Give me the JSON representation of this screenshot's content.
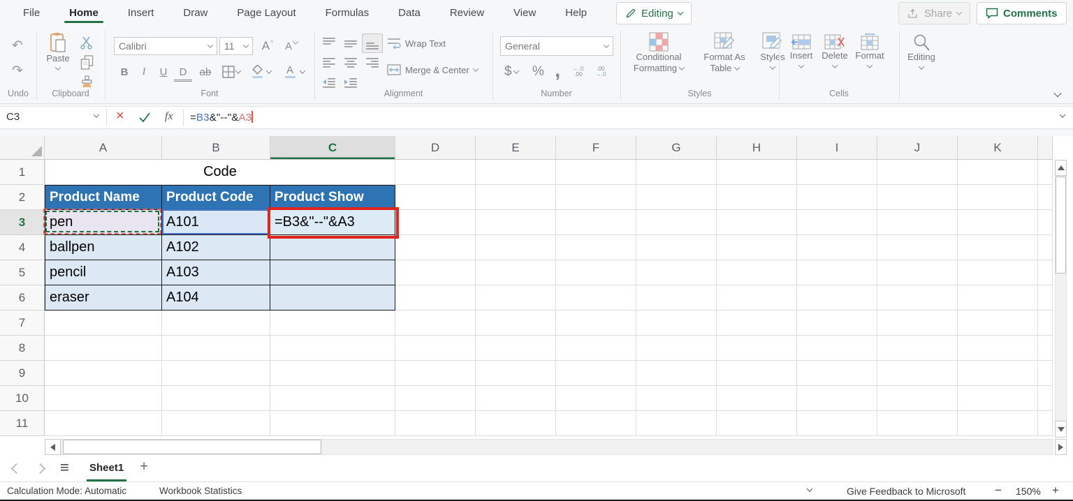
{
  "app": {
    "tabs": [
      "File",
      "Home",
      "Insert",
      "Draw",
      "Page Layout",
      "Formulas",
      "Data",
      "Review",
      "View",
      "Help"
    ],
    "active_tab": "Home",
    "editing_mode_label": "Editing",
    "share_label": "Share",
    "comments_label": "Comments"
  },
  "ribbon": {
    "group_labels": {
      "undo": "Undo",
      "clipboard": "Clipboard",
      "font": "Font",
      "alignment": "Alignment",
      "number": "Number",
      "styles": "Styles",
      "cells": "Cells"
    },
    "paste_label": "Paste",
    "font_name": "Calibri",
    "font_size": "11",
    "grow_font": "A",
    "shrink_font": "A",
    "bold": "B",
    "italic": "I",
    "underline": "U",
    "double_underline": "D",
    "strikethrough": "ab",
    "wrap_text_label": "Wrap Text",
    "merge_center_label": "Merge & Center",
    "number_format": "General",
    "currency": "$",
    "percent": "%",
    "comma": ",",
    "inc_dec_top": "←.0",
    "inc_dec_bot": ".00",
    "dec_dec_top": ".00",
    "dec_dec_bot": "→.0",
    "cond_fmt_l1": "Conditional",
    "cond_fmt_l2": "Formatting",
    "fmt_table_l1": "Format As",
    "fmt_table_l2": "Table",
    "styles_label": "Styles",
    "insert_label": "Insert",
    "delete_label": "Delete",
    "format_label": "Format",
    "editing_label": "Editing"
  },
  "formula_bar": {
    "name_box": "C3",
    "fx_label": "fx",
    "parts": [
      {
        "t": "=",
        "c": "d"
      },
      {
        "t": "B3",
        "c": "b"
      },
      {
        "t": "&\"--\"&",
        "c": "d"
      },
      {
        "t": "A3",
        "c": "r"
      }
    ]
  },
  "sheet": {
    "col_letters": [
      "A",
      "B",
      "C",
      "D",
      "E",
      "F",
      "G",
      "H",
      "I",
      "J",
      "K"
    ],
    "active_col": "C",
    "row_numbers": [
      1,
      2,
      3,
      4,
      5,
      6,
      7,
      8,
      9,
      10,
      11
    ],
    "active_row": 3,
    "title_cell": "Code",
    "header_row": [
      "Product Name",
      "Product Code",
      "Product Show"
    ],
    "data_rows": [
      [
        "pen",
        "A101",
        "=B3&\"--\"&A3"
      ],
      [
        "ballpen",
        "A102",
        ""
      ],
      [
        "pencil",
        "A103",
        ""
      ],
      [
        "eraser",
        "A104",
        ""
      ]
    ]
  },
  "sheet_bar": {
    "sheet_name": "Sheet1",
    "add_sheet": "+"
  },
  "status_bar": {
    "calc_mode": "Calculation Mode: Automatic",
    "workbook_stats": "Workbook Statistics",
    "feedback": "Give Feedback to Microsoft",
    "zoom_out": "−",
    "zoom_level": "150%",
    "zoom_in": "+"
  },
  "colors": {
    "accent_green": "#217346",
    "header_blue": "#2e74b5",
    "table_row_fill": "#dce9f5",
    "ref_blue": "#4472c4",
    "ref_red": "#d9736b",
    "annotation_red": "#e1251b"
  }
}
